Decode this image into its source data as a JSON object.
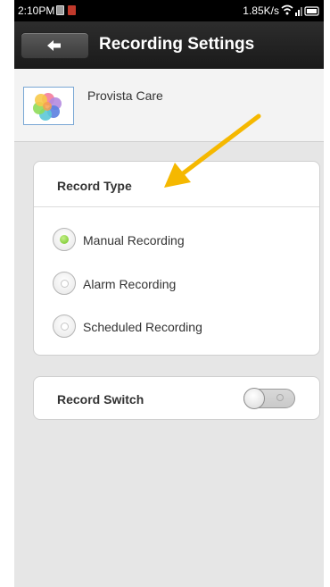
{
  "statusbar": {
    "time": "2:10PM",
    "network_speed": "1.85K/s",
    "icons": [
      "picture-icon",
      "app-notification-icon",
      "wifi-icon",
      "signal-icon",
      "battery-icon"
    ]
  },
  "titlebar": {
    "back_icon": "back-arrow-icon",
    "title": "Recording Settings"
  },
  "app": {
    "logo_icon": "colorful-flower-logo",
    "name": "Provista Care"
  },
  "record_type": {
    "title": "Record Type",
    "options": [
      {
        "label": "Manual Recording",
        "selected": true
      },
      {
        "label": "Alarm Recording",
        "selected": false
      },
      {
        "label": "Scheduled Recording",
        "selected": false
      }
    ]
  },
  "record_switch": {
    "label": "Record Switch",
    "enabled": false
  },
  "annotation": {
    "arrow_color": "#f5b800"
  }
}
